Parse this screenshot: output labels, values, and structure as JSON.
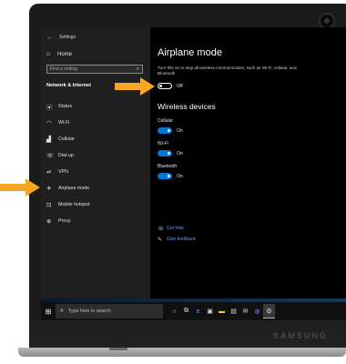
{
  "window": {
    "title": "Settings",
    "back_glyph": "←"
  },
  "sidebar": {
    "home_label": "Home",
    "search_placeholder": "Find a setting",
    "section_title": "Network & Internet",
    "items": [
      {
        "label": "Status",
        "icon": "globe-icon",
        "glyph": "⦿"
      },
      {
        "label": "Wi-Fi",
        "icon": "wifi-icon",
        "glyph": "◠"
      },
      {
        "label": "Cellular",
        "icon": "cellular-icon",
        "glyph": "▟"
      },
      {
        "label": "Dial-up",
        "icon": "dialup-icon",
        "glyph": "☏"
      },
      {
        "label": "VPN",
        "icon": "vpn-icon",
        "glyph": "⇌"
      },
      {
        "label": "Airplane mode",
        "icon": "airplane-icon",
        "glyph": "✈"
      },
      {
        "label": "Mobile hotspot",
        "icon": "hotspot-icon",
        "glyph": "⊡"
      },
      {
        "label": "Proxy",
        "icon": "globe-icon",
        "glyph": "⊕"
      }
    ]
  },
  "main": {
    "title": "Airplane mode",
    "description": "Turn this on to stop all wireless communication, such as Wi-Fi, cellular, and Bluetooth",
    "airplane_toggle": {
      "state": "Off"
    },
    "wireless_heading": "Wireless devices",
    "devices": [
      {
        "label": "Cellular",
        "state": "On"
      },
      {
        "label": "Wi-Fi",
        "state": "On"
      },
      {
        "label": "Bluetooth",
        "state": "On"
      }
    ],
    "links": [
      {
        "label": "Get help",
        "icon": "help-icon",
        "glyph": "☏"
      },
      {
        "label": "Give feedback",
        "icon": "feedback-icon",
        "glyph": "✎"
      }
    ]
  },
  "taskbar": {
    "search_placeholder": "Type here to search",
    "icons": [
      {
        "name": "cortana-icon",
        "glyph": "○"
      },
      {
        "name": "task-view-icon",
        "glyph": "⧉"
      },
      {
        "name": "edge-icon",
        "glyph": "e"
      },
      {
        "name": "store-icon",
        "glyph": "▣"
      },
      {
        "name": "explorer-icon",
        "glyph": "▬"
      },
      {
        "name": "photos-icon",
        "glyph": "▤"
      },
      {
        "name": "mail-icon",
        "glyph": "✉"
      },
      {
        "name": "media-icon",
        "glyph": "◍"
      },
      {
        "name": "settings-icon",
        "glyph": "⚙"
      }
    ]
  },
  "device": {
    "brand": "SAMSUNG"
  },
  "colors": {
    "accent": "#0078d7",
    "highlight_arrow": "#f5a623",
    "link": "#4aa3ff"
  }
}
